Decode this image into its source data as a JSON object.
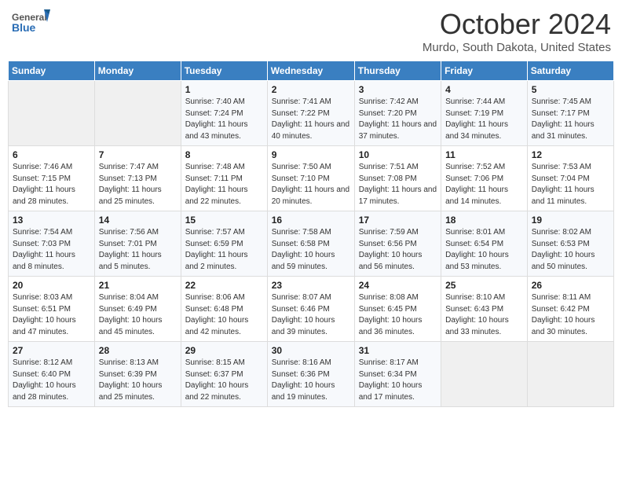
{
  "header": {
    "logo": {
      "general": "General",
      "blue": "Blue"
    },
    "title": "October 2024",
    "location": "Murdo, South Dakota, United States"
  },
  "weekdays": [
    "Sunday",
    "Monday",
    "Tuesday",
    "Wednesday",
    "Thursday",
    "Friday",
    "Saturday"
  ],
  "weeks": [
    [
      null,
      null,
      {
        "day": 1,
        "sunrise": "Sunrise: 7:40 AM",
        "sunset": "Sunset: 7:24 PM",
        "daylight": "Daylight: 11 hours and 43 minutes."
      },
      {
        "day": 2,
        "sunrise": "Sunrise: 7:41 AM",
        "sunset": "Sunset: 7:22 PM",
        "daylight": "Daylight: 11 hours and 40 minutes."
      },
      {
        "day": 3,
        "sunrise": "Sunrise: 7:42 AM",
        "sunset": "Sunset: 7:20 PM",
        "daylight": "Daylight: 11 hours and 37 minutes."
      },
      {
        "day": 4,
        "sunrise": "Sunrise: 7:44 AM",
        "sunset": "Sunset: 7:19 PM",
        "daylight": "Daylight: 11 hours and 34 minutes."
      },
      {
        "day": 5,
        "sunrise": "Sunrise: 7:45 AM",
        "sunset": "Sunset: 7:17 PM",
        "daylight": "Daylight: 11 hours and 31 minutes."
      }
    ],
    [
      {
        "day": 6,
        "sunrise": "Sunrise: 7:46 AM",
        "sunset": "Sunset: 7:15 PM",
        "daylight": "Daylight: 11 hours and 28 minutes."
      },
      {
        "day": 7,
        "sunrise": "Sunrise: 7:47 AM",
        "sunset": "Sunset: 7:13 PM",
        "daylight": "Daylight: 11 hours and 25 minutes."
      },
      {
        "day": 8,
        "sunrise": "Sunrise: 7:48 AM",
        "sunset": "Sunset: 7:11 PM",
        "daylight": "Daylight: 11 hours and 22 minutes."
      },
      {
        "day": 9,
        "sunrise": "Sunrise: 7:50 AM",
        "sunset": "Sunset: 7:10 PM",
        "daylight": "Daylight: 11 hours and 20 minutes."
      },
      {
        "day": 10,
        "sunrise": "Sunrise: 7:51 AM",
        "sunset": "Sunset: 7:08 PM",
        "daylight": "Daylight: 11 hours and 17 minutes."
      },
      {
        "day": 11,
        "sunrise": "Sunrise: 7:52 AM",
        "sunset": "Sunset: 7:06 PM",
        "daylight": "Daylight: 11 hours and 14 minutes."
      },
      {
        "day": 12,
        "sunrise": "Sunrise: 7:53 AM",
        "sunset": "Sunset: 7:04 PM",
        "daylight": "Daylight: 11 hours and 11 minutes."
      }
    ],
    [
      {
        "day": 13,
        "sunrise": "Sunrise: 7:54 AM",
        "sunset": "Sunset: 7:03 PM",
        "daylight": "Daylight: 11 hours and 8 minutes."
      },
      {
        "day": 14,
        "sunrise": "Sunrise: 7:56 AM",
        "sunset": "Sunset: 7:01 PM",
        "daylight": "Daylight: 11 hours and 5 minutes."
      },
      {
        "day": 15,
        "sunrise": "Sunrise: 7:57 AM",
        "sunset": "Sunset: 6:59 PM",
        "daylight": "Daylight: 11 hours and 2 minutes."
      },
      {
        "day": 16,
        "sunrise": "Sunrise: 7:58 AM",
        "sunset": "Sunset: 6:58 PM",
        "daylight": "Daylight: 10 hours and 59 minutes."
      },
      {
        "day": 17,
        "sunrise": "Sunrise: 7:59 AM",
        "sunset": "Sunset: 6:56 PM",
        "daylight": "Daylight: 10 hours and 56 minutes."
      },
      {
        "day": 18,
        "sunrise": "Sunrise: 8:01 AM",
        "sunset": "Sunset: 6:54 PM",
        "daylight": "Daylight: 10 hours and 53 minutes."
      },
      {
        "day": 19,
        "sunrise": "Sunrise: 8:02 AM",
        "sunset": "Sunset: 6:53 PM",
        "daylight": "Daylight: 10 hours and 50 minutes."
      }
    ],
    [
      {
        "day": 20,
        "sunrise": "Sunrise: 8:03 AM",
        "sunset": "Sunset: 6:51 PM",
        "daylight": "Daylight: 10 hours and 47 minutes."
      },
      {
        "day": 21,
        "sunrise": "Sunrise: 8:04 AM",
        "sunset": "Sunset: 6:49 PM",
        "daylight": "Daylight: 10 hours and 45 minutes."
      },
      {
        "day": 22,
        "sunrise": "Sunrise: 8:06 AM",
        "sunset": "Sunset: 6:48 PM",
        "daylight": "Daylight: 10 hours and 42 minutes."
      },
      {
        "day": 23,
        "sunrise": "Sunrise: 8:07 AM",
        "sunset": "Sunset: 6:46 PM",
        "daylight": "Daylight: 10 hours and 39 minutes."
      },
      {
        "day": 24,
        "sunrise": "Sunrise: 8:08 AM",
        "sunset": "Sunset: 6:45 PM",
        "daylight": "Daylight: 10 hours and 36 minutes."
      },
      {
        "day": 25,
        "sunrise": "Sunrise: 8:10 AM",
        "sunset": "Sunset: 6:43 PM",
        "daylight": "Daylight: 10 hours and 33 minutes."
      },
      {
        "day": 26,
        "sunrise": "Sunrise: 8:11 AM",
        "sunset": "Sunset: 6:42 PM",
        "daylight": "Daylight: 10 hours and 30 minutes."
      }
    ],
    [
      {
        "day": 27,
        "sunrise": "Sunrise: 8:12 AM",
        "sunset": "Sunset: 6:40 PM",
        "daylight": "Daylight: 10 hours and 28 minutes."
      },
      {
        "day": 28,
        "sunrise": "Sunrise: 8:13 AM",
        "sunset": "Sunset: 6:39 PM",
        "daylight": "Daylight: 10 hours and 25 minutes."
      },
      {
        "day": 29,
        "sunrise": "Sunrise: 8:15 AM",
        "sunset": "Sunset: 6:37 PM",
        "daylight": "Daylight: 10 hours and 22 minutes."
      },
      {
        "day": 30,
        "sunrise": "Sunrise: 8:16 AM",
        "sunset": "Sunset: 6:36 PM",
        "daylight": "Daylight: 10 hours and 19 minutes."
      },
      {
        "day": 31,
        "sunrise": "Sunrise: 8:17 AM",
        "sunset": "Sunset: 6:34 PM",
        "daylight": "Daylight: 10 hours and 17 minutes."
      },
      null,
      null
    ]
  ]
}
